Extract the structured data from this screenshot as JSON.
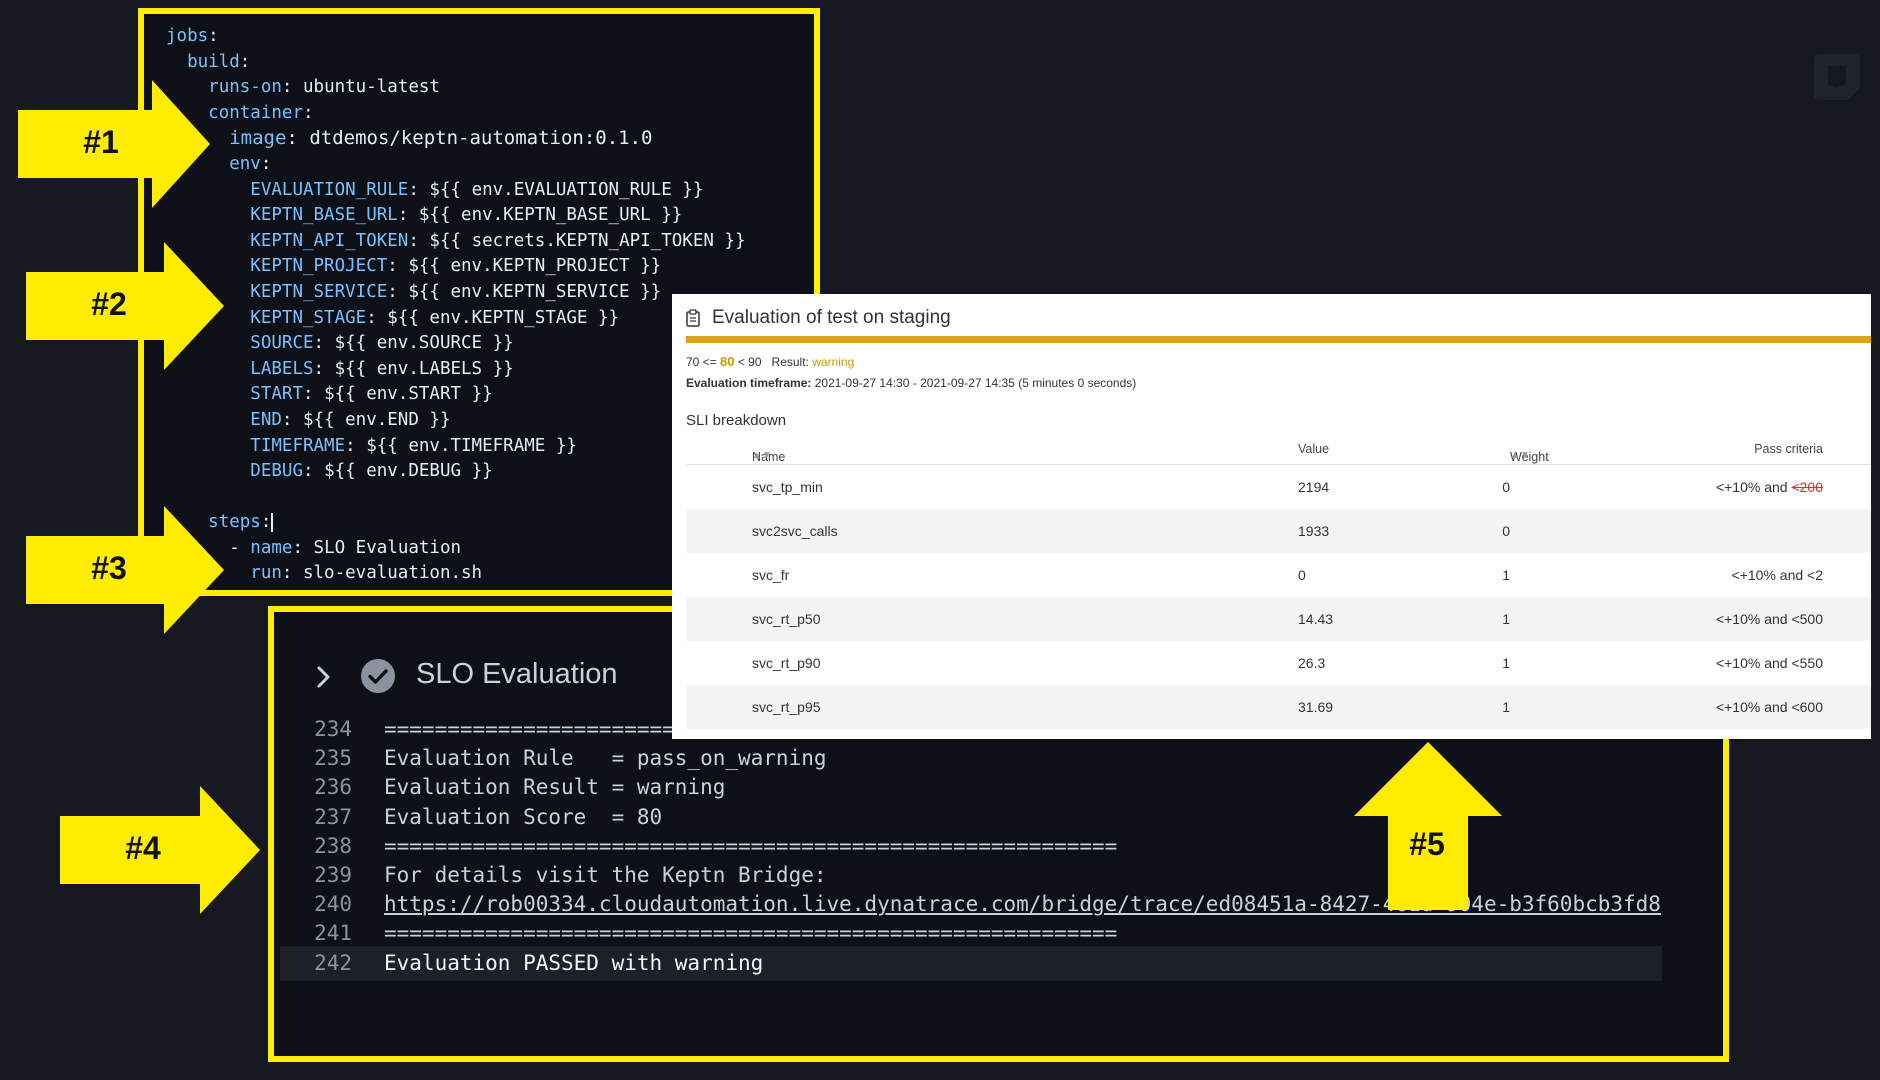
{
  "yaml": {
    "lines": [
      {
        "indent": "",
        "key": "jobs",
        "sep": ":",
        "value": ""
      },
      {
        "indent": "  ",
        "key": "build",
        "sep": ":",
        "value": ""
      },
      {
        "indent": "    ",
        "key": "runs-on",
        "sep": ": ",
        "value": "ubuntu-latest"
      },
      {
        "indent": "    ",
        "key": "container",
        "sep": ":",
        "value": ""
      },
      {
        "indent": "      ",
        "key": "image",
        "sep": ": ",
        "value": "dtdemos/keptn-automation:0.1.0"
      },
      {
        "indent": "      ",
        "key": "env",
        "sep": ":",
        "value": ""
      },
      {
        "indent": "        ",
        "key": "EVALUATION_RULE",
        "sep": ": ",
        "value": "${{ env.EVALUATION_RULE }}"
      },
      {
        "indent": "        ",
        "key": "KEPTN_BASE_URL",
        "sep": ": ",
        "value": "${{ env.KEPTN_BASE_URL }}"
      },
      {
        "indent": "        ",
        "key": "KEPTN_API_TOKEN",
        "sep": ": ",
        "value": "${{ secrets.KEPTN_API_TOKEN }}"
      },
      {
        "indent": "        ",
        "key": "KEPTN_PROJECT",
        "sep": ": ",
        "value": "${{ env.KEPTN_PROJECT }}"
      },
      {
        "indent": "        ",
        "key": "KEPTN_SERVICE",
        "sep": ": ",
        "value": "${{ env.KEPTN_SERVICE }}"
      },
      {
        "indent": "        ",
        "key": "KEPTN_STAGE",
        "sep": ": ",
        "value": "${{ env.KEPTN_STAGE }}"
      },
      {
        "indent": "        ",
        "key": "SOURCE",
        "sep": ": ",
        "value": "${{ env.SOURCE }}"
      },
      {
        "indent": "        ",
        "key": "LABELS",
        "sep": ": ",
        "value": "${{ env.LABELS }}"
      },
      {
        "indent": "        ",
        "key": "START",
        "sep": ": ",
        "value": "${{ env.START }}"
      },
      {
        "indent": "        ",
        "key": "END",
        "sep": ": ",
        "value": "${{ env.END }}"
      },
      {
        "indent": "        ",
        "key": "TIMEFRAME",
        "sep": ": ",
        "value": "${{ env.TIMEFRAME }}"
      },
      {
        "indent": "        ",
        "key": "DEBUG",
        "sep": ": ",
        "value": "${{ env.DEBUG }}"
      },
      {
        "indent": "",
        "key": "",
        "sep": "",
        "value": ""
      },
      {
        "indent": "    ",
        "key": "steps",
        "sep": ":",
        "value": "",
        "cursor": true
      },
      {
        "indent": "      - ",
        "key": "name",
        "sep": ": ",
        "value": "SLO Evaluation"
      },
      {
        "indent": "        ",
        "key": "run",
        "sep": ": ",
        "value": "slo-evaluation.sh"
      }
    ]
  },
  "arrows": {
    "a1": "#1",
    "a2": "#2",
    "a3": "#3",
    "a4": "#4",
    "a5": "#5"
  },
  "log": {
    "job_title": "SLO Evaluation",
    "lines": [
      {
        "num": "234",
        "text": "=========================================================="
      },
      {
        "num": "235",
        "text": "Evaluation Rule   = pass_on_warning"
      },
      {
        "num": "236",
        "text": "Evaluation Result = warning"
      },
      {
        "num": "237",
        "text": "Evaluation Score  = 80"
      },
      {
        "num": "238",
        "text": "=========================================================="
      },
      {
        "num": "239",
        "text": "For details visit the Keptn Bridge:"
      },
      {
        "num": "240",
        "text": "https://rob00334.cloudautomation.live.dynatrace.com/bridge/trace/ed08451a-8427-461d-904e-b3f60bcb3fd8"
      },
      {
        "num": "241",
        "text": "=========================================================="
      },
      {
        "num": "242",
        "text": "Evaluation PASSED with warning"
      }
    ]
  },
  "evaluation": {
    "title": "Evaluation of test on staging",
    "score_prefix": "70 <= ",
    "score": "80",
    "score_suffix": " < 90",
    "result_label": "Result: ",
    "result": "warning",
    "timeframe_label": "Evaluation timeframe:",
    "timeframe": "2021-09-27 14:30 - 2021-09-27 14:35 (5 minutes 0 seconds)",
    "sli_heading": "SLI breakdown",
    "columns": {
      "name": "Name",
      "value": "Value",
      "weight": "Weight",
      "pass": "Pass criteria"
    },
    "rows": [
      {
        "name": "svc_tp_min",
        "value": "2194",
        "weight": "0",
        "pass_prefix": "<+10% and ",
        "pass_value": "<200",
        "strike": true
      },
      {
        "name": "svc2svc_calls",
        "value": "1933",
        "weight": "0",
        "pass_prefix": "",
        "pass_value": "",
        "strike": false
      },
      {
        "name": "svc_fr",
        "value": "0",
        "weight": "1",
        "pass_prefix": "<+10% and ",
        "pass_value": "<2",
        "strike": false
      },
      {
        "name": "svc_rt_p50",
        "value": "14.43",
        "weight": "1",
        "pass_prefix": "<+10% and ",
        "pass_value": "<500",
        "strike": false
      },
      {
        "name": "svc_rt_p90",
        "value": "26.3",
        "weight": "1",
        "pass_prefix": "<+10% and ",
        "pass_value": "<550",
        "strike": false
      },
      {
        "name": "svc_rt_p95",
        "value": "31.69",
        "weight": "1",
        "pass_prefix": "<+10% and ",
        "pass_value": "<600",
        "strike": false
      }
    ]
  },
  "colors": {
    "highlight_yellow": "#ffed00",
    "warning": "#d9a515",
    "yaml_key": "#79c0ff",
    "failed_criteria": "#e32b2b"
  }
}
